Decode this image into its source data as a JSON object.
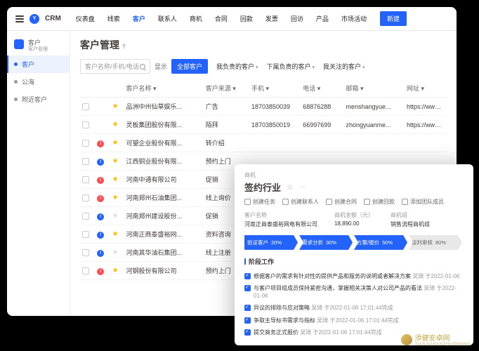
{
  "topbar": {
    "brand": "CRM",
    "nav": [
      "仪表盘",
      "线索",
      "客户",
      "联系人",
      "商机",
      "合同",
      "回款",
      "发票",
      "回访",
      "产品",
      "市场活动"
    ],
    "nav_active": 2,
    "new_btn": "新建"
  },
  "sidebar": {
    "head_title": "客户",
    "head_sub": "客户管理",
    "items": [
      "客户",
      "公海",
      "附近客户"
    ],
    "active": 0
  },
  "page": {
    "title": "客户管理",
    "title_badge": "?"
  },
  "toolbar": {
    "search_ph": "客户名称/手机/电话",
    "show": "显示",
    "all": "全部客户",
    "filters": [
      "我负责的客户",
      "下属负责的客户",
      "我关注的客户"
    ]
  },
  "table": {
    "headers": [
      "客户名称",
      "客户来源",
      "手机",
      "电话",
      "邮箱",
      "网址"
    ],
    "rows": [
      {
        "status": "",
        "star": true,
        "name": "品洲中州仙草娱乐...",
        "src": "广告",
        "mobile": "18703850039",
        "phone": "68876288",
        "email": "menshangyue...",
        "url": "https://www.1..."
      },
      {
        "status": "",
        "star": true,
        "name": "灵板集团股份有限...",
        "src": "陌拜",
        "mobile": "18703850019",
        "phone": "66997699",
        "email": "zhongyuanme...",
        "url": "https://www.1..."
      },
      {
        "status": "red",
        "star": true,
        "name": "可望企业股份有限...",
        "src": "转介绍",
        "mobile": "",
        "phone": "",
        "email": "",
        "url": ""
      },
      {
        "status": "blue",
        "star": true,
        "name": "江西铜业股份有限...",
        "src": "预约上门",
        "mobile": "",
        "phone": "",
        "email": "",
        "url": ""
      },
      {
        "status": "red",
        "star": true,
        "name": "河南中通有限公司",
        "src": "促销",
        "mobile": "",
        "phone": "",
        "email": "",
        "url": ""
      },
      {
        "status": "red",
        "star": true,
        "name": "河南郑州石油集团...",
        "src": "线上询价",
        "mobile": "",
        "phone": "",
        "email": "",
        "url": ""
      },
      {
        "status": "blue",
        "star": false,
        "name": "河南郑州建设股份...",
        "src": "促销",
        "mobile": "",
        "phone": "",
        "email": "",
        "url": ""
      },
      {
        "status": "blue",
        "star": true,
        "name": "河南正商泰盛裕网...",
        "src": "资料咨询",
        "mobile": "",
        "phone": "",
        "email": "",
        "url": ""
      },
      {
        "status": "blue",
        "star": false,
        "name": "河南其华油石集团...",
        "src": "线上注册",
        "mobile": "",
        "phone": "",
        "email": "",
        "url": ""
      },
      {
        "status": "red",
        "star": true,
        "name": "河钢股份有限公司",
        "src": "预约上门",
        "mobile": "",
        "phone": "",
        "email": "",
        "url": ""
      }
    ]
  },
  "panel": {
    "sub": "商机",
    "title": "签约行业",
    "actions": [
      "创建任务",
      "创建联系人",
      "创建合同",
      "创建回款",
      "添加团队成员"
    ],
    "fields": [
      {
        "lab": "客户名称",
        "val": "河南正商泰盛裕网电有限公司"
      },
      {
        "lab": "商机金额（元）",
        "val": "18,890.00"
      },
      {
        "lab": "商机组",
        "val": "销售流程商机组"
      }
    ],
    "stages": [
      {
        "t": "验证客户",
        "p": "20%",
        "on": true
      },
      {
        "t": "需求分析",
        "p": "30%",
        "on": true
      },
      {
        "t": "方案/报价",
        "p": "50%",
        "on": true
      },
      {
        "t": "谈判审核",
        "p": "80%",
        "on": false
      }
    ],
    "section": "阶段工作",
    "tasks": [
      {
        "text": "根据客户的需求有针对性的提供产品和服务的说明或者解决方案",
        "meta": "吴琦 于2022-01-06"
      },
      {
        "text": "与客户项目组成员保持紧密沟通，掌握相关决策人对公司产品的看法",
        "meta": "吴琦 于2022-01-06"
      },
      {
        "text": "异议的排除与应对策略",
        "meta": "吴琦 于2022-01-06 17:01:44完成"
      },
      {
        "text": "争取主导标书需求与指标",
        "meta": "吴琦 于2022-01-06 17:01:44完成"
      },
      {
        "text": "提交商务正式报价",
        "meta": "吴琦 于2022-01-06 17:01:44完成"
      }
    ]
  },
  "watermark": {
    "name": "添健安卓网",
    "sub": "TIANJIANANZHUOWANG"
  }
}
